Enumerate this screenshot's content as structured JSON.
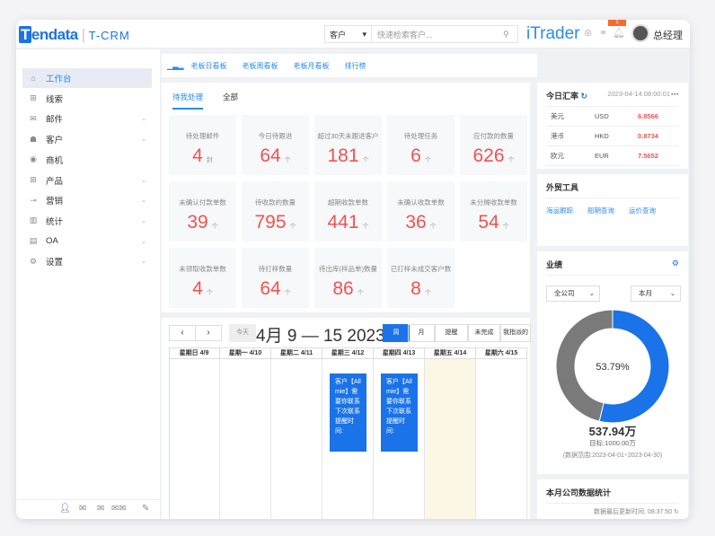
{
  "header": {
    "logo": "Tendata",
    "product": "T-CRM",
    "search_scope": "客户",
    "search_placeholder": "快速检索客户...",
    "brand": "iTrader",
    "notification_count": "1",
    "user": "总经理"
  },
  "sidebar": {
    "items": [
      {
        "label": "工作台",
        "icon": "home-icon",
        "active": true
      },
      {
        "label": "线索",
        "icon": "grid-icon"
      },
      {
        "label": "邮件",
        "icon": "mail-icon",
        "expand": true
      },
      {
        "label": "客户",
        "icon": "customer-icon",
        "expand": true
      },
      {
        "label": "商机",
        "icon": "opportunity-icon"
      },
      {
        "label": "产品",
        "icon": "product-icon",
        "expand": true
      },
      {
        "label": "营销",
        "icon": "marketing-icon",
        "expand": true
      },
      {
        "label": "统计",
        "icon": "chart-icon",
        "expand": true
      },
      {
        "label": "OA",
        "icon": "oa-icon",
        "expand": true
      },
      {
        "label": "设置",
        "icon": "settings-icon",
        "expand": true
      }
    ]
  },
  "board_tabs": [
    "老板日看板",
    "老板周看板",
    "老板月看板",
    "排行榜"
  ],
  "sub_tabs": [
    "待我处理",
    "全部"
  ],
  "cards": [
    {
      "label": "待处理邮件",
      "value": "4",
      "unit": "封"
    },
    {
      "label": "今日待跟进",
      "value": "64",
      "unit": "个"
    },
    {
      "label": "超过30天未跟进客户",
      "value": "181",
      "unit": "个"
    },
    {
      "label": "待处理任务",
      "value": "6",
      "unit": "个"
    },
    {
      "label": "应付款的数量",
      "value": "626",
      "unit": "个"
    },
    {
      "label": "未确认付款单数",
      "value": "39",
      "unit": "个"
    },
    {
      "label": "待收款的数量",
      "value": "795",
      "unit": "个"
    },
    {
      "label": "超期收款单数",
      "value": "441",
      "unit": "个"
    },
    {
      "label": "未确认收款单数",
      "value": "36",
      "unit": "个"
    },
    {
      "label": "未分摊收款单数",
      "value": "54",
      "unit": "个"
    },
    {
      "label": "未领取收款单数",
      "value": "4",
      "unit": "个"
    },
    {
      "label": "待打样数量",
      "value": "64",
      "unit": "个"
    },
    {
      "label": "待出库(样品单)数量",
      "value": "86",
      "unit": "个"
    },
    {
      "label": "已打样未成交客户数",
      "value": "8",
      "unit": "个"
    }
  ],
  "calendar": {
    "prev": "‹",
    "next": "›",
    "today": "今天",
    "title": "4月 9 — 15 2023",
    "views": [
      "周",
      "月",
      "提醒",
      "未完成",
      "我指派的"
    ],
    "active_view": "周",
    "days": [
      "星期日 4/9",
      "星期一 4/10",
      "星期二 4/11",
      "星期三 4/12",
      "星期四 4/13",
      "星期五 4/14",
      "星期六 4/15"
    ],
    "events": [
      {
        "day": 3,
        "text": "客户【Allmie】需要你联系 下次联系提醒时间:"
      },
      {
        "day": 4,
        "text": "客户【Allmie】需要你联系 下次联系提醒时间:"
      }
    ]
  },
  "rates": {
    "title": "今日汇率",
    "time": "2023-04-14 08:00:01",
    "rows": [
      {
        "name": "美元",
        "code": "USD",
        "value": "6.8566"
      },
      {
        "name": "港币",
        "code": "HKD",
        "value": "0.8734"
      },
      {
        "name": "欧元",
        "code": "EUR",
        "value": "7.5652"
      }
    ]
  },
  "tools": {
    "title": "外贸工具",
    "links": [
      "海运跟踪",
      "船期查询",
      "运价查询"
    ]
  },
  "performance": {
    "title": "业绩",
    "scope": "全公司",
    "period": "本月",
    "percent": 53.79,
    "percent_label": "53.79%",
    "amount": "537.94万",
    "target": "目标:1000.00万",
    "range": "(数据范围:2023-04-01~2023-04-30)",
    "colors": {
      "done": "#1a73e8",
      "rest": "#7a7a7a"
    }
  },
  "monthly": {
    "title": "本月公司数据统计",
    "updated": "数据最后更新时间: 08:37:50"
  }
}
